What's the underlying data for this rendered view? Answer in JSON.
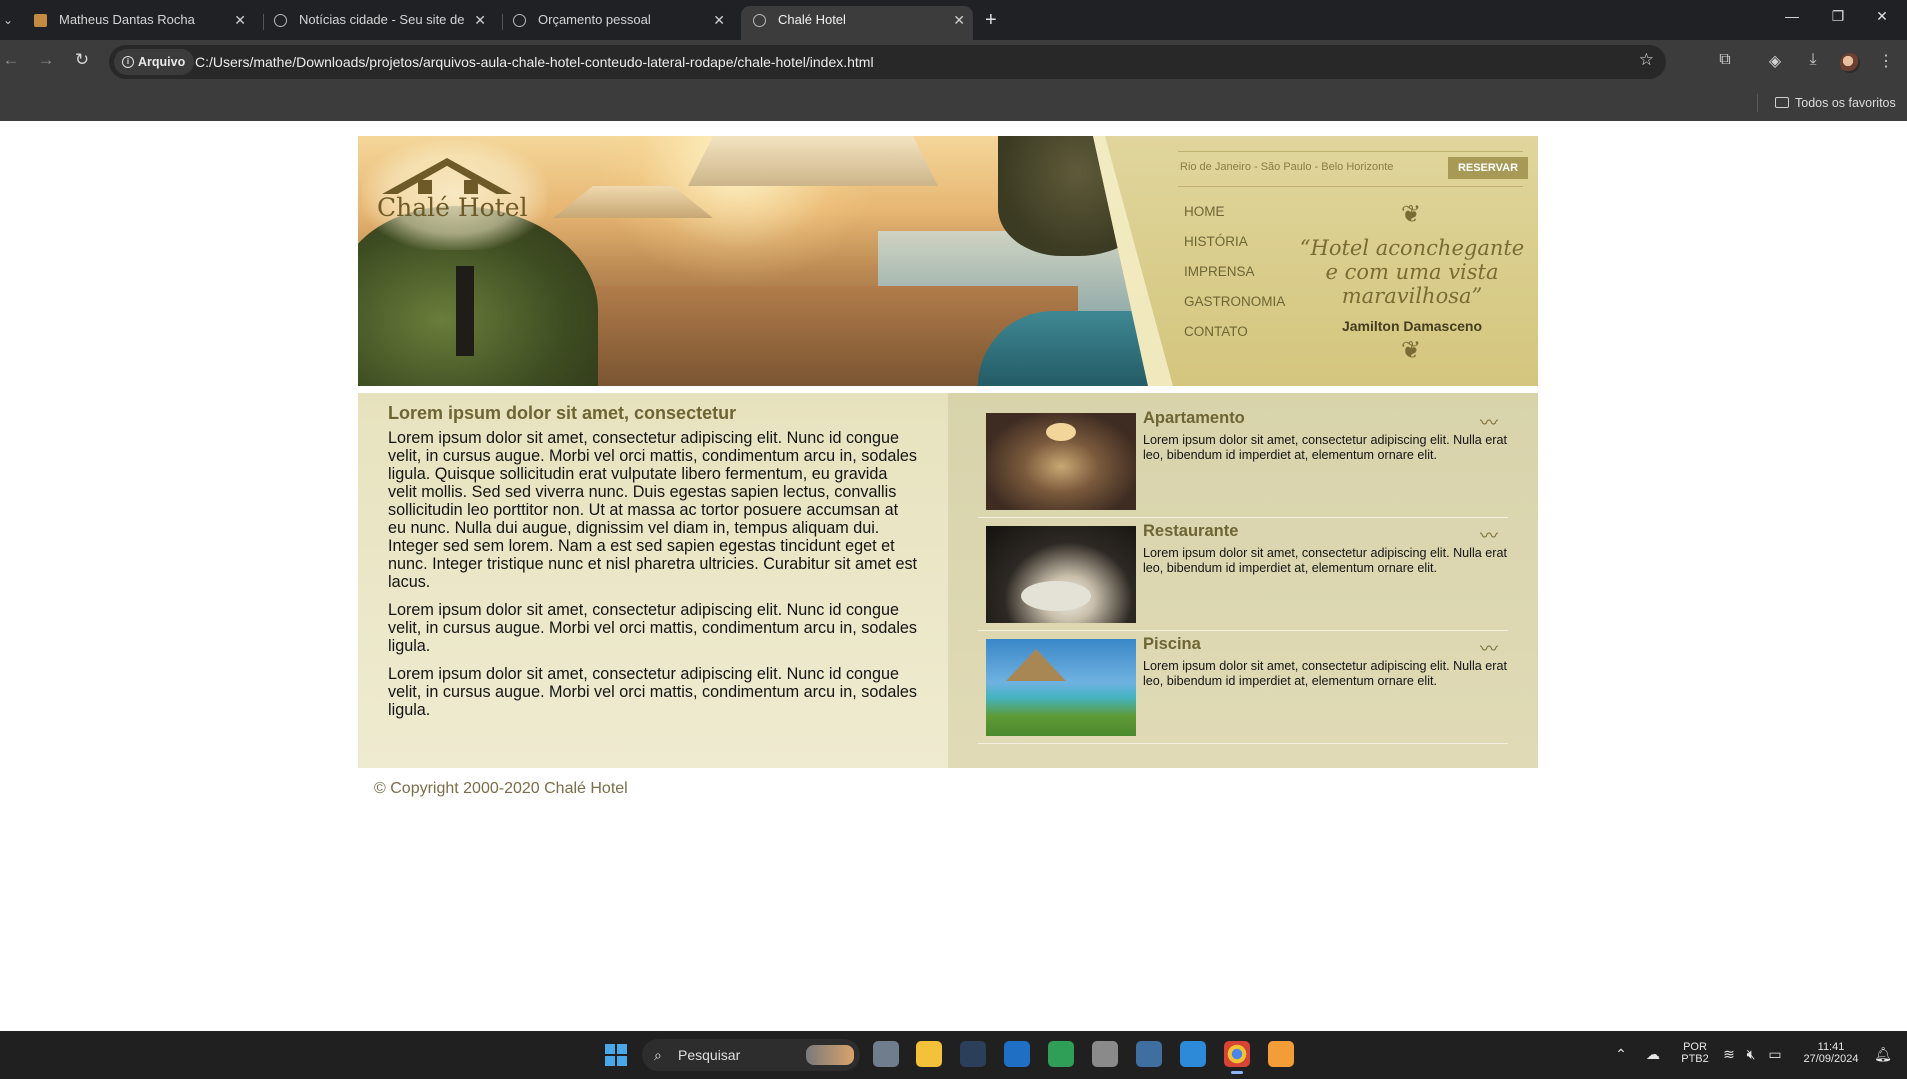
{
  "browser": {
    "tabs": [
      {
        "label": "Matheus Dantas Rocha",
        "active": false
      },
      {
        "label": "Notícias cidade - Seu site de no",
        "active": false
      },
      {
        "label": "Orçamento pessoal",
        "active": false
      },
      {
        "label": "Chalé Hotel",
        "active": true
      }
    ],
    "security_chip": "Arquivo",
    "url": "C:/Users/mathe/Downloads/projetos/arquivos-aula-chale-hotel-conteudo-lateral-rodape/chale-hotel/index.html",
    "bookmarks_folder": "Todos os favoritos"
  },
  "site": {
    "logo_text": "Chalé Hotel",
    "cities": "Rio de Janeiro - São Paulo - Belo Horizonte",
    "reserve_label": "RESERVAR",
    "menu": [
      "HOME",
      "HISTÓRIA",
      "IMPRENSA",
      "GASTRONOMIA",
      "CONTATO"
    ],
    "quote": "“Hotel aconchegante e com uma vista maravilhosa”",
    "quote_author": "Jamilton Damasceno",
    "main": {
      "title": "Lorem ipsum dolor sit amet, consectetur",
      "paragraphs": [
        "Lorem ipsum dolor sit amet, consectetur adipiscing elit. Nunc id congue velit, in cursus augue. Morbi vel orci mattis, condimentum arcu in, sodales ligula. Quisque sollicitudin erat vulputate libero fermentum, eu gravida velit mollis. Sed sed viverra nunc. Duis egestas sapien lectus, convallis sollicitudin leo porttitor non. Ut at massa ac tortor posuere accumsan at eu nunc. Nulla dui augue, dignissim vel diam in, tempus aliquam dui. Integer sed sem lorem. Nam a est sed sapien egestas tincidunt eget et nunc. Integer tristique nunc et nisl pharetra ultricies. Curabitur sit amet est lacus.",
        "Lorem ipsum dolor sit amet, consectetur adipiscing elit. Nunc id congue velit, in cursus augue. Morbi vel orci mattis, condimentum arcu in, sodales ligula.",
        "Lorem ipsum dolor sit amet, consectetur adipiscing elit. Nunc id congue velit, in cursus augue. Morbi vel orci mattis, condimentum arcu in, sodales ligula."
      ]
    },
    "side_items": [
      {
        "title": "Apartamento",
        "text": "Lorem ipsum dolor sit amet, consectetur adipiscing elit. Nulla erat leo, bibendum id imperdiet at, elementum ornare elit."
      },
      {
        "title": "Restaurante",
        "text": "Lorem ipsum dolor sit amet, consectetur adipiscing elit. Nulla erat leo, bibendum id imperdiet at, elementum ornare elit."
      },
      {
        "title": "Piscina",
        "text": "Lorem ipsum dolor sit amet, consectetur adipiscing elit. Nulla erat leo, bibendum id imperdiet at, elementum ornare elit."
      }
    ],
    "footer": "© Copyright 2000-2020 Chalé Hotel"
  },
  "taskbar": {
    "search_placeholder": "Pesquisar",
    "language": "POR",
    "keyboard": "PTB2",
    "time": "11:41",
    "date": "27/09/2024"
  },
  "colors": {
    "accent": "#6e6535",
    "header_bg": "#d9cc8c",
    "button": "#a79a57"
  }
}
